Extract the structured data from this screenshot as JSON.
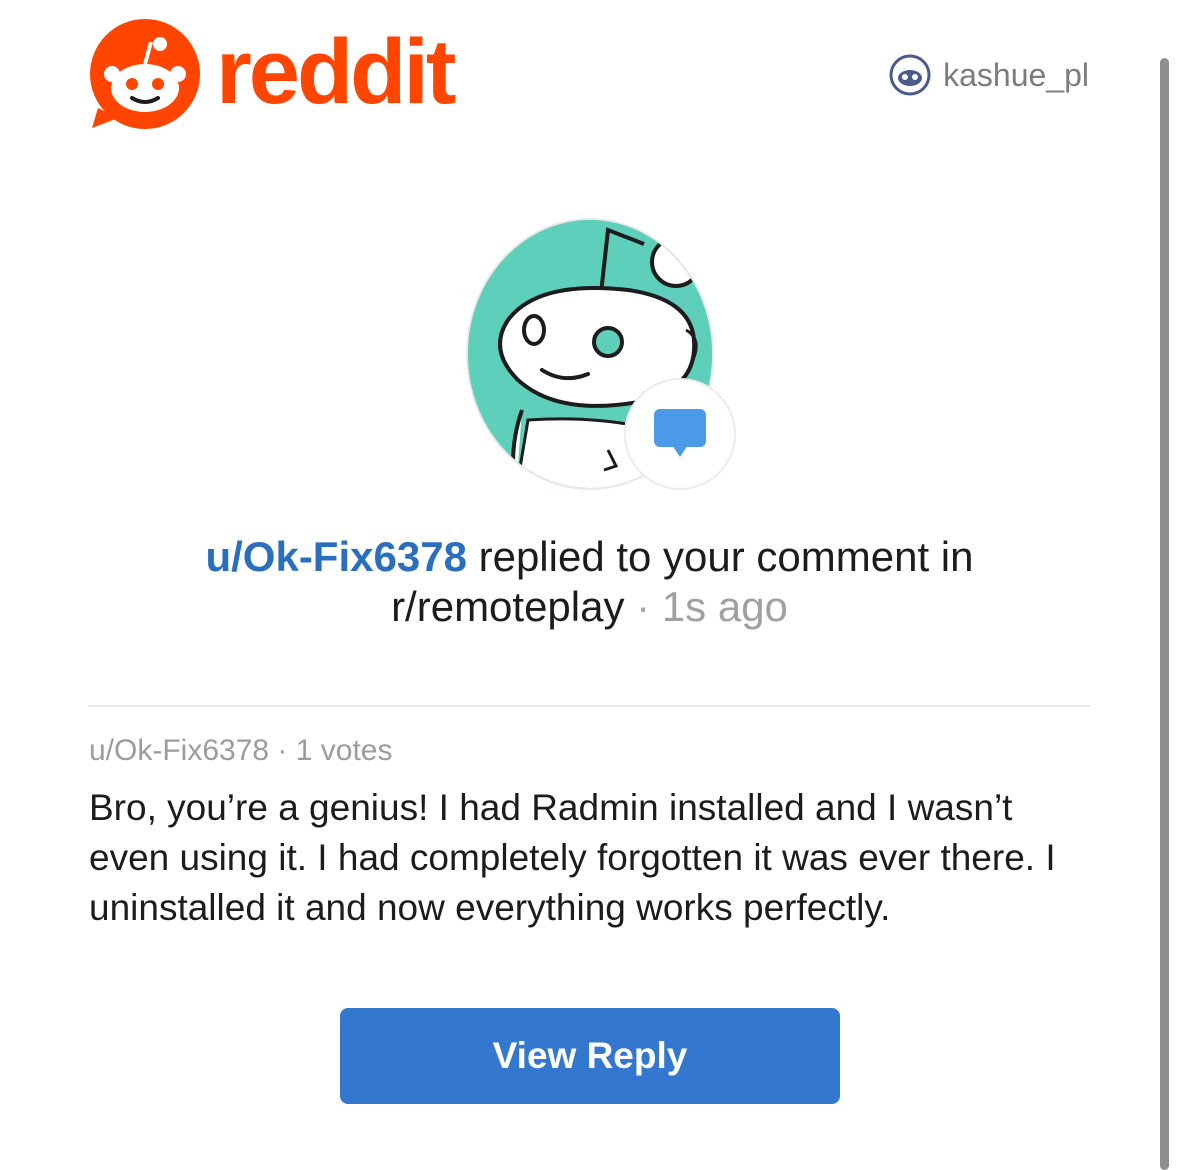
{
  "brand": {
    "name": "reddit",
    "color": "#ff4500"
  },
  "account": {
    "username": "kashue_pl"
  },
  "notification": {
    "author": "u/Ok-Fix6378",
    "action_text": " replied to your comment in",
    "subreddit": "r/remoteplay",
    "separator": " · ",
    "time": "1s ago"
  },
  "comment": {
    "author": "u/Ok-Fix6378",
    "separator": " · ",
    "votes": "1 votes",
    "body": "Bro, you’re a genius! I had Radmin installed and I wasn’t even using it. I had completely forgotten it was ever there. I uninstalled it and now everything works perfectly."
  },
  "cta": {
    "label": "View Reply",
    "color": "#3477cf"
  },
  "icons": {
    "logo": "reddit-snoo-icon",
    "user_avatar": "snoo-avatar-icon",
    "badge": "chat-bubble-icon"
  }
}
